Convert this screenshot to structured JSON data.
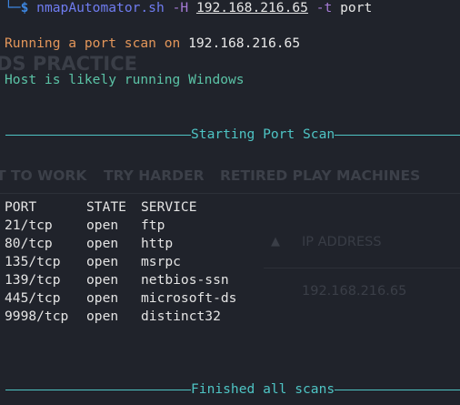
{
  "background_page": {
    "heading": "DS PRACTICE",
    "tabs": [
      "T TO WORK",
      "TRY HARDER",
      "RETIRED PLAY MACHINES"
    ],
    "ip_header": "IP ADDRESS",
    "ip_value": "192.168.216.65"
  },
  "terminal": {
    "prompt_corner": "└─",
    "prompt_symbol": "$",
    "command": "nmapAutomator.sh",
    "flag_host": "-H",
    "host_ip": "192.168.216.65",
    "flag_type": "-t",
    "type_value": "port",
    "scan_msg_prefix": "Running a port scan on ",
    "scan_msg_ip": "192.168.216.65",
    "os_msg": "Host is likely running Windows",
    "section_start": "Starting Port Scan",
    "section_end": "Finished all scans",
    "table": {
      "headers": [
        "PORT",
        "STATE",
        "SERVICE"
      ],
      "rows": [
        {
          "port": "21/tcp",
          "state": "open",
          "service": "ftp"
        },
        {
          "port": "80/tcp",
          "state": "open",
          "service": "http"
        },
        {
          "port": "135/tcp",
          "state": "open",
          "service": "msrpc"
        },
        {
          "port": "139/tcp",
          "state": "open",
          "service": "netbios-ssn"
        },
        {
          "port": "445/tcp",
          "state": "open",
          "service": "microsoft-ds"
        },
        {
          "port": "9998/tcp",
          "state": "open",
          "service": "distinct32"
        }
      ]
    }
  },
  "colors": {
    "background": "#20232b",
    "prompt": "#3d86e0",
    "command": "#6f7cf0",
    "orange": "#e3965a",
    "green": "#5bc3a6",
    "cyan": "#4ec4c4"
  }
}
